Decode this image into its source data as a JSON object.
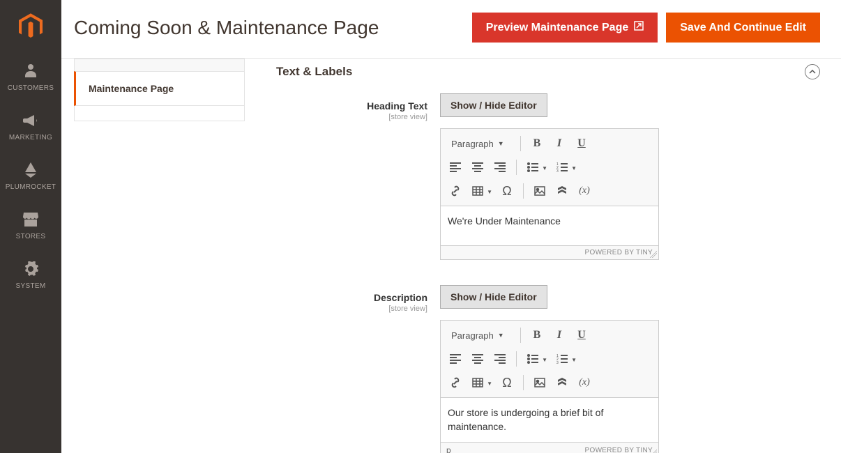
{
  "header": {
    "title": "Coming Soon & Maintenance Page",
    "preview_label": "Preview Maintenance Page",
    "save_label": "Save And Continue Edit"
  },
  "sidebar": {
    "items": [
      {
        "label": "CUSTOMERS"
      },
      {
        "label": "MARKETING"
      },
      {
        "label": "PLUMROCKET"
      },
      {
        "label": "STORES"
      },
      {
        "label": "SYSTEM"
      }
    ]
  },
  "tabs": {
    "active": "Maintenance Page"
  },
  "section": {
    "title": "Text & Labels"
  },
  "fields": {
    "heading": {
      "label": "Heading Text",
      "scope": "[store view]",
      "toggle": "Show / Hide Editor",
      "value": "We're Under Maintenance"
    },
    "description": {
      "label": "Description",
      "scope": "[store view]",
      "toggle": "Show / Hide Editor",
      "value": "Our store is undergoing a brief bit of maintenance.",
      "path": "p"
    }
  },
  "editor": {
    "format_label": "Paragraph",
    "powered": "POWERED BY TINY"
  }
}
